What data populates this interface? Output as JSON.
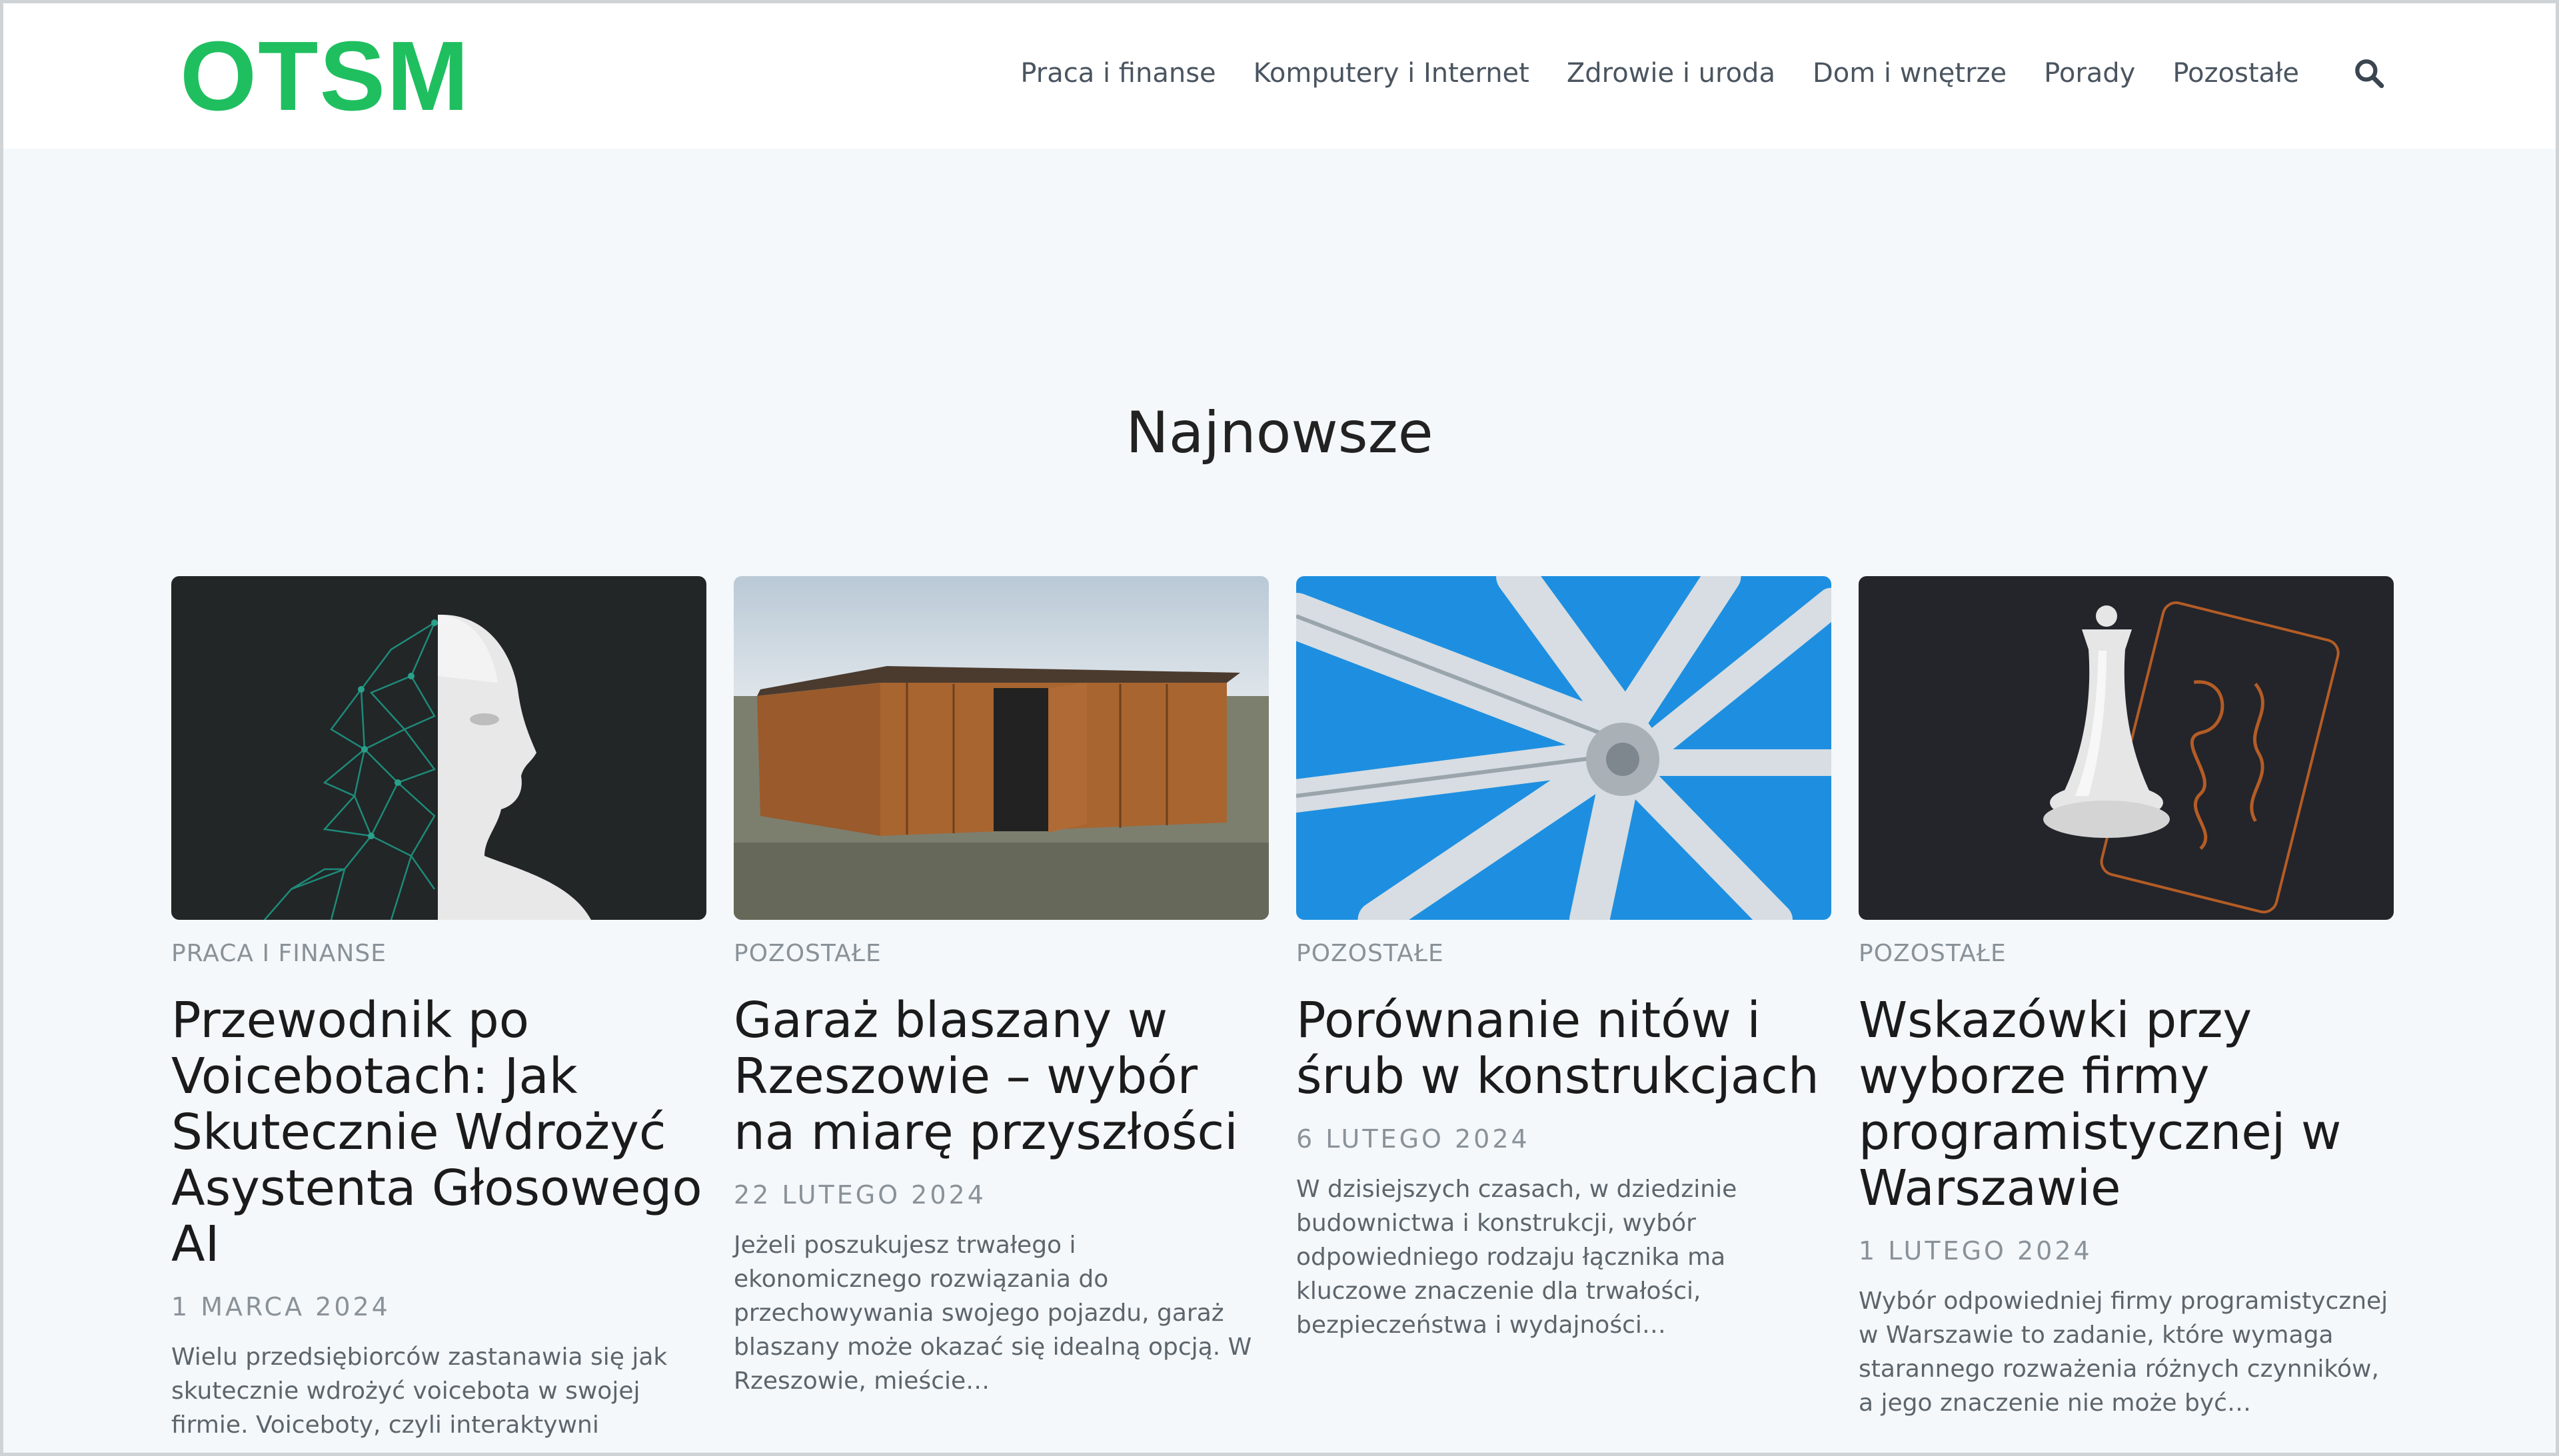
{
  "site": {
    "logo": "OTSM"
  },
  "nav": {
    "items": [
      "Praca i finanse",
      "Komputery i Internet",
      "Zdrowie i uroda",
      "Dom i wnętrze",
      "Porady",
      "Pozostałe"
    ],
    "search_icon": "search-icon"
  },
  "section": {
    "title": "Najnowsze"
  },
  "posts": [
    {
      "category": "Praca i finanse",
      "title": "Przewodnik po Voicebotach: Jak Skutecznie Wdrożyć Asystenta Głosowego AI",
      "date": "1 marca 2024",
      "excerpt": "Wielu przedsiębiorców zastanawia się jak skutecznie wdrożyć voicebota w swojej firmie. Voiceboty, czyli interaktywni"
    },
    {
      "category": "Pozostałe",
      "title": "Garaż blaszany w Rzeszowie – wybór na miarę przyszłości",
      "date": "22 lutego 2024",
      "excerpt": "Jeżeli poszukujesz trwałego i ekonomicznego rozwiązania do przechowywania swojego pojazdu, garaż blaszany może okazać się idealną opcją. W Rzeszowie, mieście…"
    },
    {
      "category": "Pozostałe",
      "title": "Porównanie nitów i śrub w konstrukcjach",
      "date": "6 lutego 2024",
      "excerpt": "W dzisiejszych czasach, w dziedzinie budownictwa i konstrukcji, wybór odpowiedniego rodzaju łącznika ma kluczowe znaczenie dla trwałości, bezpieczeństwa i wydajności…"
    },
    {
      "category": "Pozostałe",
      "title": "Wskazówki przy wyborze firmy programistycznej w Warszawie",
      "date": "1 lutego 2024",
      "excerpt": "Wybór odpowiedniej firmy programistycznej w Warszawie to zadanie, które wymaga starannego rozważenia różnych czynników, a jego znaczenie nie może być…"
    }
  ],
  "colors": {
    "brand": "#1fbf5f",
    "background": "#f4f8fb",
    "header": "#ffffff"
  }
}
